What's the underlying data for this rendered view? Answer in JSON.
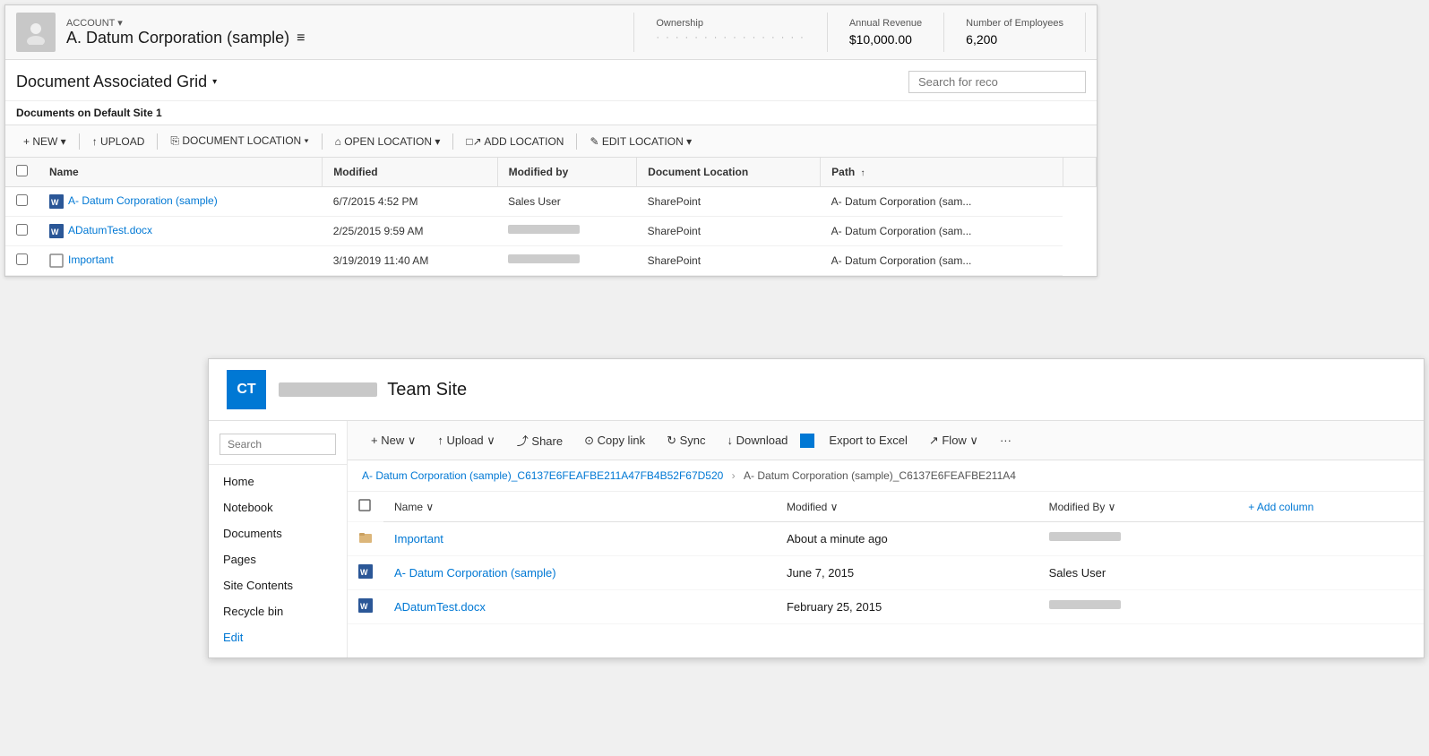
{
  "crm": {
    "account_label": "ACCOUNT ▾",
    "account_name": "A. Datum Corporation (sample)",
    "hamburger": "≡",
    "stats": {
      "ownership_label": "Ownership",
      "ownership_value": "· · · · · · · · · · · · · · · · · · · · · ·",
      "revenue_label": "Annual Revenue",
      "revenue_value": "$10,000.00",
      "employees_label": "Number of Employees",
      "employees_value": "6,200"
    }
  },
  "doc_grid": {
    "title": "Document Associated Grid",
    "title_chevron": "▾",
    "search_placeholder": "Search for reco",
    "site_label": "Documents on Default Site 1",
    "toolbar": {
      "new": "+ NEW ▾",
      "upload": "↑ UPLOAD",
      "doc_location": "⎘ DOCUMENT LOCATION ▾",
      "open_location": "⌂ OPEN LOCATION ▾",
      "add_location": "□↗ ADD LOCATION",
      "edit_location": "✎ EDIT LOCATION ▾"
    },
    "columns": [
      "Name",
      "Modified",
      "Modified by",
      "Document Location",
      "Path ↑"
    ],
    "rows": [
      {
        "icon": "word",
        "name": "A- Datum Corporation (sample)",
        "modified": "6/7/2015 4:52 PM",
        "modified_by": "Sales User",
        "doc_location": "SharePoint",
        "path": "A- Datum Corporation (sam..."
      },
      {
        "icon": "word",
        "name": "ADatumTest.docx",
        "modified": "2/25/2015 9:59 AM",
        "modified_by": "BLURRED",
        "doc_location": "SharePoint",
        "path": "A- Datum Corporation (sam..."
      },
      {
        "icon": "generic",
        "name": "Important",
        "modified": "3/19/2019 11:40 AM",
        "modified_by": "BLURRED",
        "doc_location": "SharePoint",
        "path": "A- Datum Corporation (sam..."
      }
    ]
  },
  "sharepoint": {
    "logo_text": "CT",
    "site_name": "Team Site",
    "search_placeholder": "Search",
    "nav_items": [
      "Home",
      "Notebook",
      "Documents",
      "Pages",
      "Site Contents",
      "Recycle bin",
      "Edit"
    ],
    "toolbar": {
      "new": "+ New ∨",
      "upload": "↑ Upload ∨",
      "share": "⤴ Share",
      "copy_link": "⊙ Copy link",
      "sync": "↻ Sync",
      "download": "↓ Download",
      "export_excel": "Export to Excel",
      "flow": "↗ Flow ∨",
      "more": "···"
    },
    "breadcrumb_parts": [
      "A- Datum Corporation (sample)_C6137E6FEAFBE211A47FB4B52F67D520",
      "A- Datum Corporation (sample)_C6137E6FEAFBE211A4"
    ],
    "breadcrumb_sep": ">",
    "columns": [
      "Name ∨",
      "Modified ∨",
      "Modified By ∨",
      "+ Add column"
    ],
    "rows": [
      {
        "icon": "folder",
        "name": "Important",
        "modified": "About a minute ago",
        "modified_by": "BLURRED"
      },
      {
        "icon": "word",
        "name": "A- Datum Corporation (sample)",
        "modified": "June 7, 2015",
        "modified_by": "Sales User"
      },
      {
        "icon": "word",
        "name": "ADatumTest.docx",
        "modified": "February 25, 2015",
        "modified_by": "BLURRED"
      }
    ]
  }
}
